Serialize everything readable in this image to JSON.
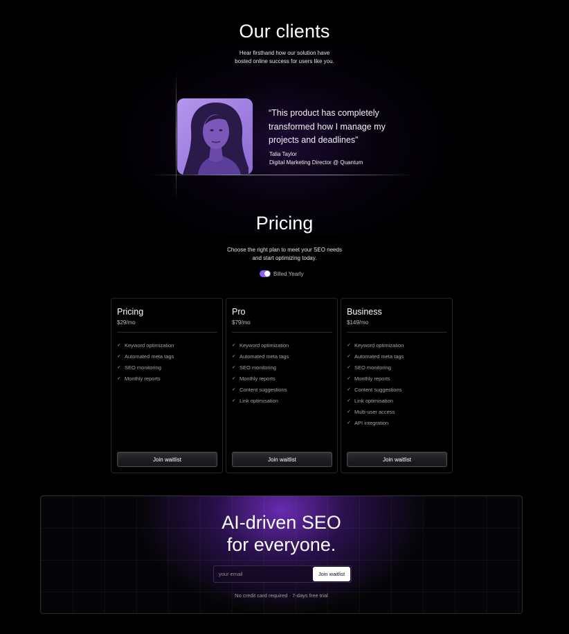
{
  "clients": {
    "title": "Our clients",
    "subtitle_line1": "Hear firsthand how our solution have",
    "subtitle_line2": "bosted online success for users like you.",
    "testimonial": {
      "quote": "“This product has completely transformed how I manage my projects and deadlines”",
      "author_name": "Talia Taylor",
      "author_role": "Digital Marketing Director @ Quantum"
    }
  },
  "pricing": {
    "title": "Pricing",
    "subtitle_line1": "Choose the right plan to meet your SEO needs",
    "subtitle_line2": "and start optimizing today.",
    "toggle_label": "Billed Yearly",
    "toggle_on": true,
    "accent_color": "#8a5cf0",
    "plans": [
      {
        "name": "Pricing",
        "price": "$29/mo",
        "features": [
          "Keyword optimization",
          "Automated meta tags",
          "SEO monitoring",
          "Monthly reports"
        ],
        "button": "Join waitlist"
      },
      {
        "name": "Pro",
        "price": "$79/mo",
        "features": [
          "Keyword optimization",
          "Automated meta tags",
          "SEO monitoring",
          "Monthly reports",
          "Content suggestions",
          "Link optimisation"
        ],
        "button": "Join waitlist"
      },
      {
        "name": "Business",
        "price": "$149/mo",
        "features": [
          "Keyword optimization",
          "Automated meta tags",
          "SEO monitoring",
          "Monthly reports",
          "Content suggestions",
          "Link optimisation",
          "Multi-user access",
          "API integration"
        ],
        "button": "Join waitlist"
      }
    ]
  },
  "cta": {
    "title_line1": "AI-driven SEO",
    "title_line2": "for everyone.",
    "email_placeholder": "your email",
    "button": "Join waitlist",
    "note": "No credit card required · 7-days free trial",
    "glow_color": "#6e2db9"
  },
  "icons": {
    "check": "check-icon"
  }
}
